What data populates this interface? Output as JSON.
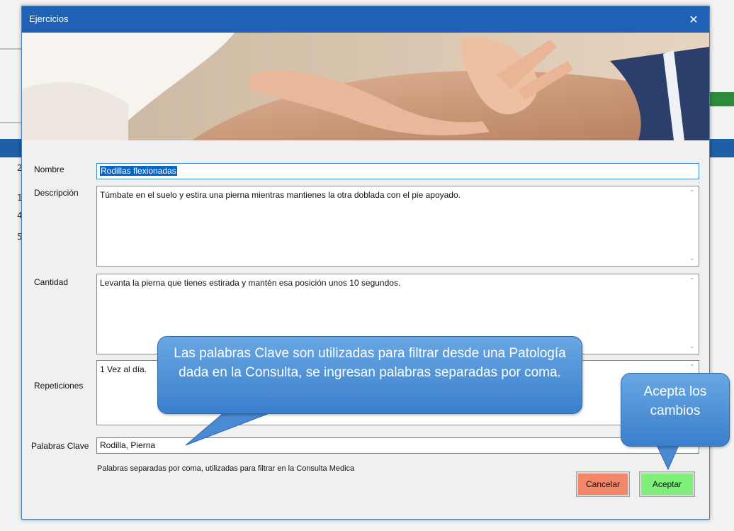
{
  "window": {
    "title": "Ejercicios",
    "close_glyph": "✕"
  },
  "form": {
    "nombre": {
      "label": "Nombre",
      "value": "Rodillas flexionadas"
    },
    "descripcion": {
      "label": "Descripción",
      "value": "Túmbate  en el suelo y estira una pierna mientras mantienes la otra doblada con el pie apoyado."
    },
    "cantidad": {
      "label": "Cantidad",
      "value": "Levanta la pierna que tienes estirada y mantén esa posición unos 10 segundos."
    },
    "repeticiones": {
      "label": "Repeticiones",
      "value": "1 Vez al día."
    },
    "palabras_clave": {
      "label": "Palabras Clave",
      "value": "Rodilla, Pierna"
    },
    "hint": "Palabras separadas por coma, utilizadas para filtrar en la Consulta Medica"
  },
  "buttons": {
    "cancel_label": "Cancelar",
    "accept_label": "Aceptar"
  },
  "callouts": {
    "keywords": "Las palabras Clave son utilizadas para filtrar desde una Patología dada en la Consulta, se ingresan palabras separadas por coma.",
    "accept": "Acepta los cambios"
  },
  "background": {
    "row_glyphs": [
      "2",
      "1",
      "4",
      "5"
    ]
  },
  "colors": {
    "titlebar": "#1e61b5",
    "cancel": "#f4866a",
    "accept": "#7ef07a",
    "callout": "#4a8fd6"
  },
  "icons": {
    "scroll_up": "⌃",
    "scroll_down": "⌄"
  }
}
